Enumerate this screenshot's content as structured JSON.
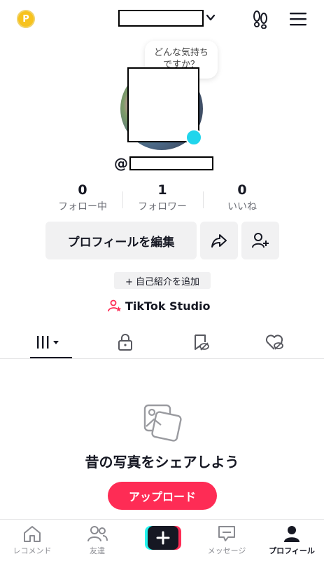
{
  "header": {
    "coin_letter": "P",
    "icons": [
      "coin-icon",
      "chevron-down-icon",
      "footprint-icon",
      "menu-icon"
    ]
  },
  "bubble": {
    "text_line1": "どんな気持ち",
    "text_line2": "ですか？"
  },
  "profile": {
    "at_sign": "@"
  },
  "stats": [
    {
      "value": "0",
      "label": "フォロー中"
    },
    {
      "value": "1",
      "label": "フォロワー"
    },
    {
      "value": "0",
      "label": "いいね"
    }
  ],
  "actions": {
    "edit_label": "プロフィールを編集",
    "bio_label": "+ 自己紹介を追加",
    "studio_label": "TikTok Studio"
  },
  "tabs": [
    "videos-grid-icon",
    "lock-icon",
    "tagged-icon",
    "liked-hidden-icon"
  ],
  "empty_state": {
    "title": "昔の写真をシェアしよう",
    "button": "アップロード"
  },
  "bottom_nav": [
    {
      "label": "レコメンド",
      "icon": "home-icon"
    },
    {
      "label": "友達",
      "icon": "friends-icon"
    },
    {
      "label": "",
      "icon": "create-plus-icon"
    },
    {
      "label": "メッセージ",
      "icon": "message-icon"
    },
    {
      "label": "プロフィール",
      "icon": "profile-icon"
    }
  ],
  "colors": {
    "accent": "#fe2c55",
    "cyan": "#20d5ec",
    "coin": "#f7c21d"
  }
}
